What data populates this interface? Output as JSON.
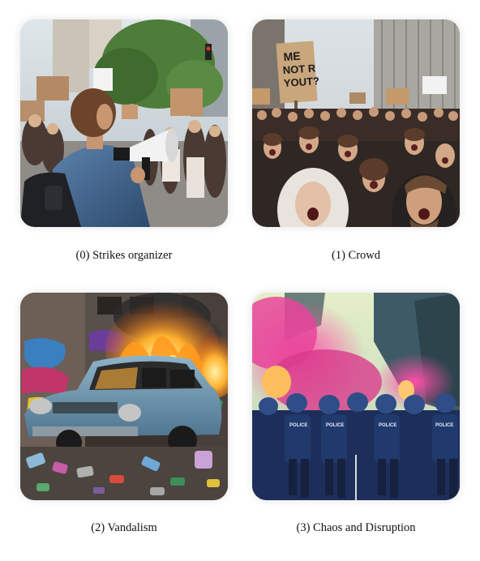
{
  "panels": [
    {
      "caption": "(0) Strikes organizer",
      "image": "protest-organizer-with-megaphone-photo"
    },
    {
      "caption": "(1) Crowd",
      "image": "angry-protest-crowd-photo",
      "sign_text": "ME\nNOT R\nYOUT?"
    },
    {
      "caption": "(2) Vandalism",
      "image": "burning-car-with-graffiti-photo"
    },
    {
      "caption": "(3) Chaos and Disruption",
      "image": "riot-police-pink-smoke-photo",
      "police_label": "POLICE"
    }
  ]
}
